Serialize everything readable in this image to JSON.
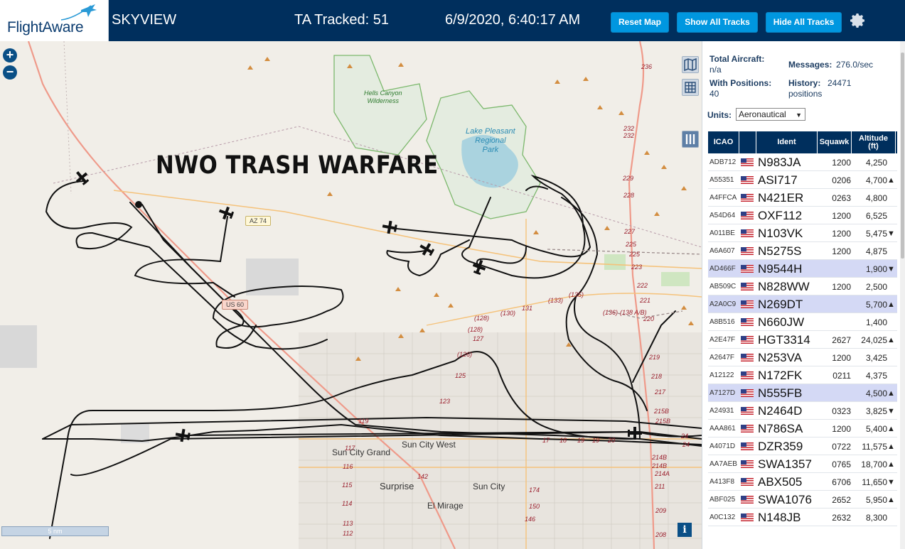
{
  "header": {
    "logo": "FlightAware",
    "app_title": "SKYVIEW",
    "tracked": "TA Tracked: 51",
    "clock": "6/9/2020, 6:40:17 AM",
    "buttons": {
      "reset": "Reset Map",
      "show": "Show All Tracks",
      "hide": "Hide All Tracks"
    },
    "settings_icon": "gear-icon"
  },
  "map": {
    "overlay_text": "NWO TRASH WARFARE",
    "zoom_in": "+",
    "zoom_out": "−",
    "info": "i",
    "scale": "5 nm",
    "labels": {
      "hells_canyon": "Hells Canyon\nWilderness",
      "lake": "Lake Pleasant\nRegional\nPark",
      "sun_city_grand": "Sun City Grand",
      "sun_city_west": "Sun City West",
      "surprise": "Surprise",
      "sun_city": "Sun City",
      "el_mirage": "El Mirage"
    },
    "shields": {
      "az74": "AZ 74",
      "us60": "US 60"
    },
    "highway_numbers": [
      "236",
      "232",
      "232",
      "229",
      "228",
      "227",
      "225",
      "225",
      "223",
      "222",
      "221",
      "220",
      "219",
      "218",
      "217",
      "215B",
      "215B",
      "214B",
      "214B",
      "214A",
      "211",
      "209",
      "208",
      "24",
      "24",
      "(136)",
      "(138 A/B)",
      "(135)",
      "(133)",
      "131",
      "(130)",
      "(128)",
      "(128)",
      "127",
      "(126)",
      "125",
      "123",
      "119",
      "117",
      "116",
      "115",
      "114",
      "113",
      "112",
      "142",
      "17",
      "18",
      "19",
      "19",
      "20",
      "174",
      "150",
      "146"
    ]
  },
  "panel": {
    "total_aircraft_label": "Total Aircraft:",
    "total_aircraft_value": "n/a",
    "messages_label": "Messages:",
    "messages_value": "276.0/sec",
    "with_positions_label": "With Positions:",
    "with_positions_value": "40",
    "history_label": "History:",
    "history_value": "24471",
    "history_unit": "positions",
    "units_label": "Units:",
    "units_value": "Aeronautical",
    "columns": [
      "ICAO",
      "",
      "Ident",
      "Squawk",
      "Altitude\n(ft)"
    ],
    "rows": [
      {
        "icao": "ADB712",
        "ident": "N983JA",
        "squawk": "1200",
        "alt": "4,250",
        "trend": "",
        "hl": false
      },
      {
        "icao": "A55351",
        "ident": "ASI717",
        "squawk": "0206",
        "alt": "4,700",
        "trend": "▲",
        "hl": false
      },
      {
        "icao": "A4FFCA",
        "ident": "N421ER",
        "squawk": "0263",
        "alt": "4,800",
        "trend": "",
        "hl": false
      },
      {
        "icao": "A54D64",
        "ident": "OXF112",
        "squawk": "1200",
        "alt": "6,525",
        "trend": "",
        "hl": false
      },
      {
        "icao": "A011BE",
        "ident": "N103VK",
        "squawk": "1200",
        "alt": "5,475",
        "trend": "▼",
        "hl": false
      },
      {
        "icao": "A6A607",
        "ident": "N5275S",
        "squawk": "1200",
        "alt": "4,875",
        "trend": "",
        "hl": false
      },
      {
        "icao": "AD466F",
        "ident": "N9544H",
        "squawk": "",
        "alt": "1,900",
        "trend": "▼",
        "hl": true
      },
      {
        "icao": "AB509C",
        "ident": "N828WW",
        "squawk": "1200",
        "alt": "2,500",
        "trend": "",
        "hl": false
      },
      {
        "icao": "A2A0C9",
        "ident": "N269DT",
        "squawk": "",
        "alt": "5,700",
        "trend": "▲",
        "hl": true
      },
      {
        "icao": "A8B516",
        "ident": "N660JW",
        "squawk": "",
        "alt": "1,400",
        "trend": "",
        "hl": false
      },
      {
        "icao": "A2E47F",
        "ident": "HGT3314",
        "squawk": "2627",
        "alt": "24,025",
        "trend": "▲",
        "hl": false
      },
      {
        "icao": "A2647F",
        "ident": "N253VA",
        "squawk": "1200",
        "alt": "3,425",
        "trend": "",
        "hl": false
      },
      {
        "icao": "A12122",
        "ident": "N172FK",
        "squawk": "0211",
        "alt": "4,375",
        "trend": "",
        "hl": false
      },
      {
        "icao": "A7127D",
        "ident": "N555FB",
        "squawk": "",
        "alt": "4,500",
        "trend": "▲",
        "hl": true
      },
      {
        "icao": "A24931",
        "ident": "N2464D",
        "squawk": "0323",
        "alt": "3,825",
        "trend": "▼",
        "hl": false
      },
      {
        "icao": "AAA861",
        "ident": "N786SA",
        "squawk": "1200",
        "alt": "5,400",
        "trend": "▲",
        "hl": false
      },
      {
        "icao": "A4071D",
        "ident": "DZR359",
        "squawk": "0722",
        "alt": "11,575",
        "trend": "▲",
        "hl": false
      },
      {
        "icao": "AA7AEB",
        "ident": "SWA1357",
        "squawk": "0765",
        "alt": "18,700",
        "trend": "▲",
        "hl": false
      },
      {
        "icao": "A413F8",
        "ident": "ABX505",
        "squawk": "6706",
        "alt": "11,650",
        "trend": "▼",
        "hl": false
      },
      {
        "icao": "ABF025",
        "ident": "SWA1076",
        "squawk": "2652",
        "alt": "5,950",
        "trend": "▲",
        "hl": false
      },
      {
        "icao": "A0C132",
        "ident": "N148JB",
        "squawk": "2632",
        "alt": "8,300",
        "trend": "",
        "hl": false
      }
    ]
  }
}
